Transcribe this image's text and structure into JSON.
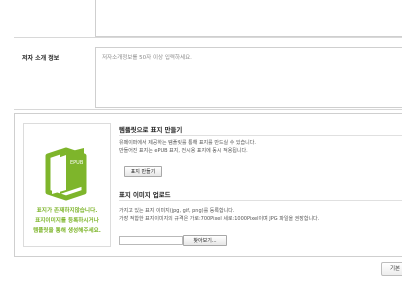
{
  "author_info": {
    "label": "저자 소개 정보",
    "placeholder": "저자소개정보를 50자 이상 입력하세요."
  },
  "cover": {
    "preview_badge": "EPUB",
    "no_cover_lines": [
      "표지가 존재하지않습니다.",
      "표지이미지를 등록하시거나",
      "템플릿을 통해 생성해주세요."
    ],
    "template_section": {
      "title": "템플릿으로 표지 만들기",
      "desc_lines": [
        "유페이퍼에서 제공하는 템플릿를 통해 표지를 만드실 수 있습니다.",
        "만들어진 표지는 ePUB 표지, 전시용 표지에 동시 적용됩니다."
      ],
      "button": "표지 만들기"
    },
    "upload_section": {
      "title": "표지 이미지 업로드",
      "desc_lines": [
        "가지고 있는 표지 이미지(jpg, gif, png)를 등록합니다.",
        "가장 적합한 표지이미지의 규격은 가로:700Pixel 세로:1000Pixel이며 JPG 파일을 권장합니다."
      ],
      "browse_button": "찾아보기..."
    }
  },
  "footer": {
    "button": "기본"
  },
  "colors": {
    "accent_green": "#7eb52b",
    "border": "#cfcfcf"
  }
}
